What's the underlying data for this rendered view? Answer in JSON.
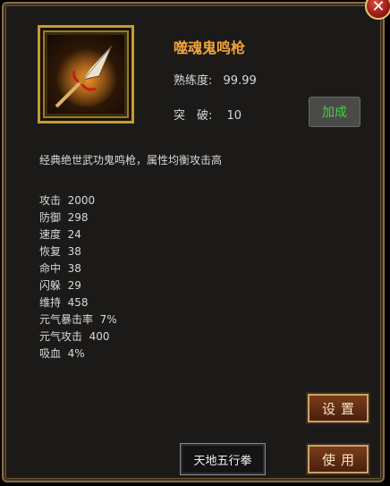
{
  "close_icon": "close-icon",
  "item": {
    "name": "噬魂鬼鸣枪",
    "proficiency_label": "熟练度:",
    "proficiency_value": "99.99",
    "break_label": "突　破:",
    "break_value": "10",
    "description": "经典绝世武功鬼鸣枪，属性均衡攻击高",
    "icon": "spear-icon"
  },
  "buttons": {
    "boost": "加成",
    "settings": "设置",
    "use": "使用",
    "tag": "天地五行拳"
  },
  "stats": [
    {
      "label": "攻击",
      "value": "2000"
    },
    {
      "label": "防御",
      "value": "298"
    },
    {
      "label": "速度",
      "value": "24"
    },
    {
      "label": "恢复",
      "value": "38"
    },
    {
      "label": "命中",
      "value": "38"
    },
    {
      "label": "闪躲",
      "value": "29"
    },
    {
      "label": "维持",
      "value": "458"
    },
    {
      "label": "元气暴击率",
      "value": "7%"
    },
    {
      "label": "元气攻击",
      "value": "400"
    },
    {
      "label": "吸血",
      "value": "4%"
    }
  ],
  "colors": {
    "name": "#f2a43a",
    "boost_text": "#3fd33f",
    "frame_gold": "#c69b2e"
  }
}
